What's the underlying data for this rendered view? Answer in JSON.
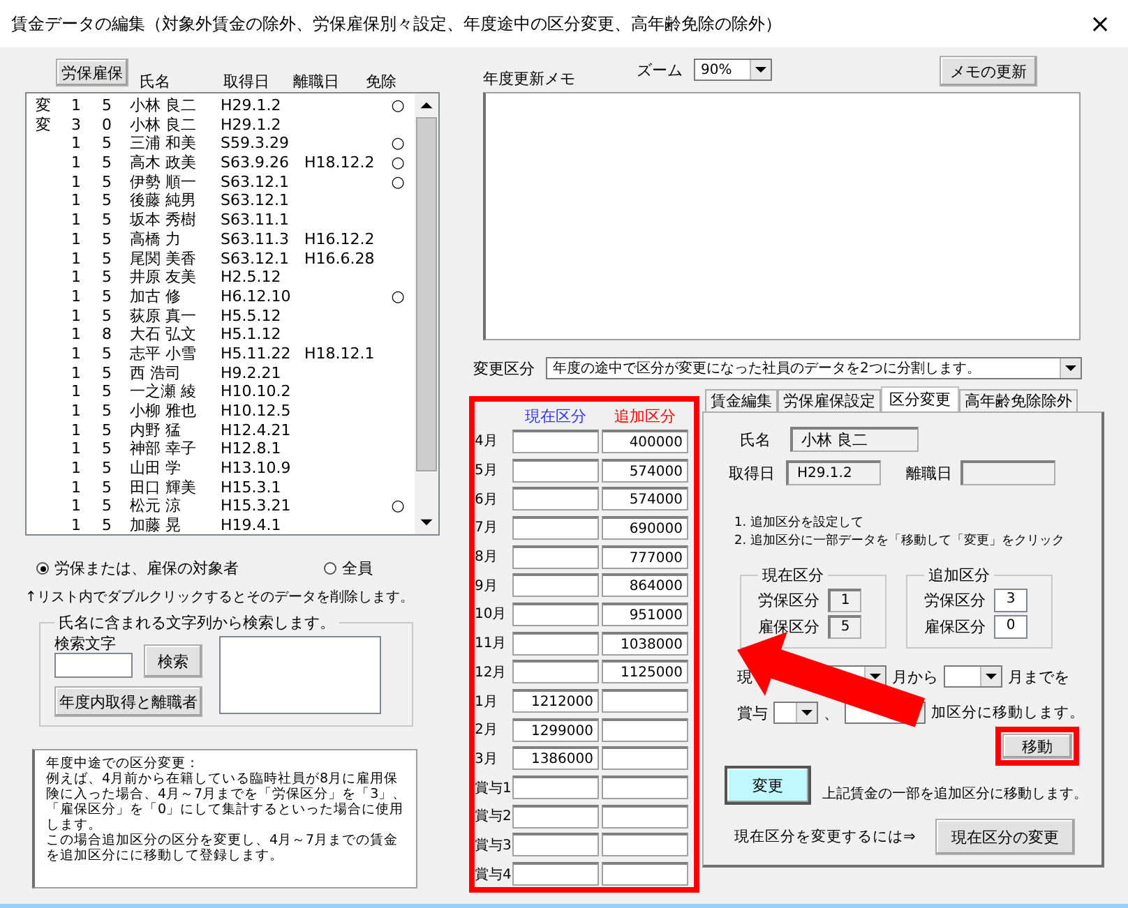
{
  "window": {
    "title": "賃金データの編集（対象外賃金の除外、労保雇保別々設定、年度途中の区分変更、高年齢免除の除外）",
    "close": "×"
  },
  "employee_list": {
    "filter_button": "労保雇保",
    "columns": [
      "氏名",
      "取得日",
      "離職日",
      "免除"
    ],
    "rows": [
      {
        "mark": "変",
        "c1": "1",
        "c2": "5",
        "name": "小林 良二",
        "acquired": "H29.1.2",
        "exempt": "○"
      },
      {
        "mark": "変",
        "c1": "3",
        "c2": "0",
        "name": "小林 良二",
        "acquired": "H29.1.2"
      },
      {
        "c1": "1",
        "c2": "5",
        "name": "三浦 和美",
        "acquired": "S59.3.29",
        "exempt": "○"
      },
      {
        "c1": "1",
        "c2": "5",
        "name": "高木 政美",
        "acquired": "S63.9.26",
        "left": "H18.12.2",
        "exempt": "○"
      },
      {
        "c1": "1",
        "c2": "5",
        "name": "伊勢 順一",
        "acquired": "S63.12.1",
        "exempt": "○"
      },
      {
        "c1": "1",
        "c2": "5",
        "name": "後藤 純男",
        "acquired": "S63.12.1"
      },
      {
        "c1": "1",
        "c2": "5",
        "name": "坂本 秀樹",
        "acquired": "S63.11.1"
      },
      {
        "c1": "1",
        "c2": "5",
        "name": "高橋 力",
        "acquired": "S63.11.3",
        "left": "H16.12.2"
      },
      {
        "c1": "1",
        "c2": "5",
        "name": "尾関 美香",
        "acquired": "S63.12.1",
        "left": "H16.6.28"
      },
      {
        "c1": "1",
        "c2": "5",
        "name": "井原 友美",
        "acquired": "H2.5.12"
      },
      {
        "c1": "1",
        "c2": "5",
        "name": "加古 修",
        "acquired": "H6.12.10",
        "exempt": "○"
      },
      {
        "c1": "1",
        "c2": "5",
        "name": "荻原 真一",
        "acquired": "H5.5.12"
      },
      {
        "c1": "1",
        "c2": "8",
        "name": "大石 弘文",
        "acquired": "H5.1.12"
      },
      {
        "c1": "1",
        "c2": "5",
        "name": "志平 小雪",
        "acquired": "H5.11.22",
        "left": "H18.12.1"
      },
      {
        "c1": "1",
        "c2": "5",
        "name": "西 浩司",
        "acquired": "H9.2.21"
      },
      {
        "c1": "1",
        "c2": "5",
        "name": "一之瀬 綾",
        "acquired": "H10.10.2"
      },
      {
        "c1": "1",
        "c2": "5",
        "name": "小柳 雅也",
        "acquired": "H10.12.5"
      },
      {
        "c1": "1",
        "c2": "5",
        "name": "内野 猛",
        "acquired": "H12.4.21"
      },
      {
        "c1": "1",
        "c2": "5",
        "name": "神部 幸子",
        "acquired": "H12.8.1"
      },
      {
        "c1": "1",
        "c2": "5",
        "name": "山田 学",
        "acquired": "H13.10.9"
      },
      {
        "c1": "1",
        "c2": "5",
        "name": "田口 輝美",
        "acquired": "H15.3.1"
      },
      {
        "c1": "1",
        "c2": "5",
        "name": "松元 涼",
        "acquired": "H15.3.21",
        "exempt": "○"
      },
      {
        "c1": "1",
        "c2": "5",
        "name": "加藤 晃",
        "acquired": "H19.4.1"
      }
    ]
  },
  "filter_radios": [
    {
      "label": "労保または、雇保の対象者",
      "selected": true
    },
    {
      "label": "全員",
      "selected": false
    }
  ],
  "list_hint": "↑リスト内でダブルクリックするとそのデータを削除します。",
  "search_group": {
    "legend": "氏名に含まれる文字列から検索します。",
    "field_label": "検索文字",
    "search_button": "検索",
    "list_button": "年度内取得と離職者"
  },
  "explanation": [
    "年度中途での区分変更：",
    "例えば、4月前から在籍している臨時社員が8月に雇用保険に入った場合、4月～7月までを「労保区分」を「3」、「雇保区分」を「0」にして集計するといった場合に使用します。",
    "この場合追加区分の区分を変更し、4月～7月までの賃金を追加区分にに移動して登録します。"
  ],
  "memo": {
    "label": "年度更新メモ",
    "zoom_label": "ズーム",
    "zoom_value": "90%",
    "update_button": "メモの更新"
  },
  "change_type": {
    "label": "変更区分",
    "value": "年度の途中で区分が変更になった社員のデータを2つに分割します。"
  },
  "wages": {
    "current_header": "現在区分",
    "added_header": "追加区分",
    "rows": [
      {
        "month": "4月",
        "added": "400000"
      },
      {
        "month": "5月",
        "added": "574000"
      },
      {
        "month": "6月",
        "added": "574000"
      },
      {
        "month": "7月",
        "added": "690000"
      },
      {
        "month": "8月",
        "added": "777000"
      },
      {
        "month": "9月",
        "added": "864000"
      },
      {
        "month": "10月",
        "added": "951000"
      },
      {
        "month": "11月",
        "added": "1038000"
      },
      {
        "month": "12月",
        "added": "1125000"
      },
      {
        "month": "1月",
        "current": "1212000"
      },
      {
        "month": "2月",
        "current": "1299000"
      },
      {
        "month": "3月",
        "current": "1386000"
      },
      {
        "month": "賞与1"
      },
      {
        "month": "賞与2"
      },
      {
        "month": "賞与3"
      },
      {
        "month": "賞与4"
      }
    ]
  },
  "tabs": [
    {
      "label": "賃金編集",
      "selected": false
    },
    {
      "label": "労保雇保設定",
      "selected": false
    },
    {
      "label": "区分変更",
      "selected": true
    },
    {
      "label": "高年齢免除除外",
      "selected": false
    }
  ],
  "division_tab": {
    "name_label": "氏名",
    "name_value": "小林 良二",
    "acquired_label": "取得日",
    "acquired_value": "H29.1.2",
    "left_label": "離職日",
    "steps": [
      "1. 追加区分を設定して",
      "2. 追加区分に一部データを「移動して「変更」をクリック"
    ],
    "current_group": {
      "legend": "現在区分",
      "rows": [
        {
          "label": "労保区分",
          "value": "1"
        },
        {
          "label": "雇保区分",
          "value": "5"
        }
      ]
    },
    "added_group": {
      "legend": "追加区分",
      "rows": [
        {
          "label": "労保区分",
          "value": "3"
        },
        {
          "label": "雇保区分",
          "value": "0"
        }
      ]
    },
    "month_range": {
      "prefix": "現",
      "from_suffix": "月から",
      "to_suffix": "月までを"
    },
    "bonus_range": {
      "prefix": "賞与",
      "separator": "、",
      "suffix": "加区分に移動します。"
    },
    "move_button": "移動",
    "change_button": "変更",
    "change_note": "上記賃金の一部を追加区分に移動します。",
    "current_change_label": "現在区分を変更するには⇒",
    "current_change_button": "現在区分の変更"
  }
}
